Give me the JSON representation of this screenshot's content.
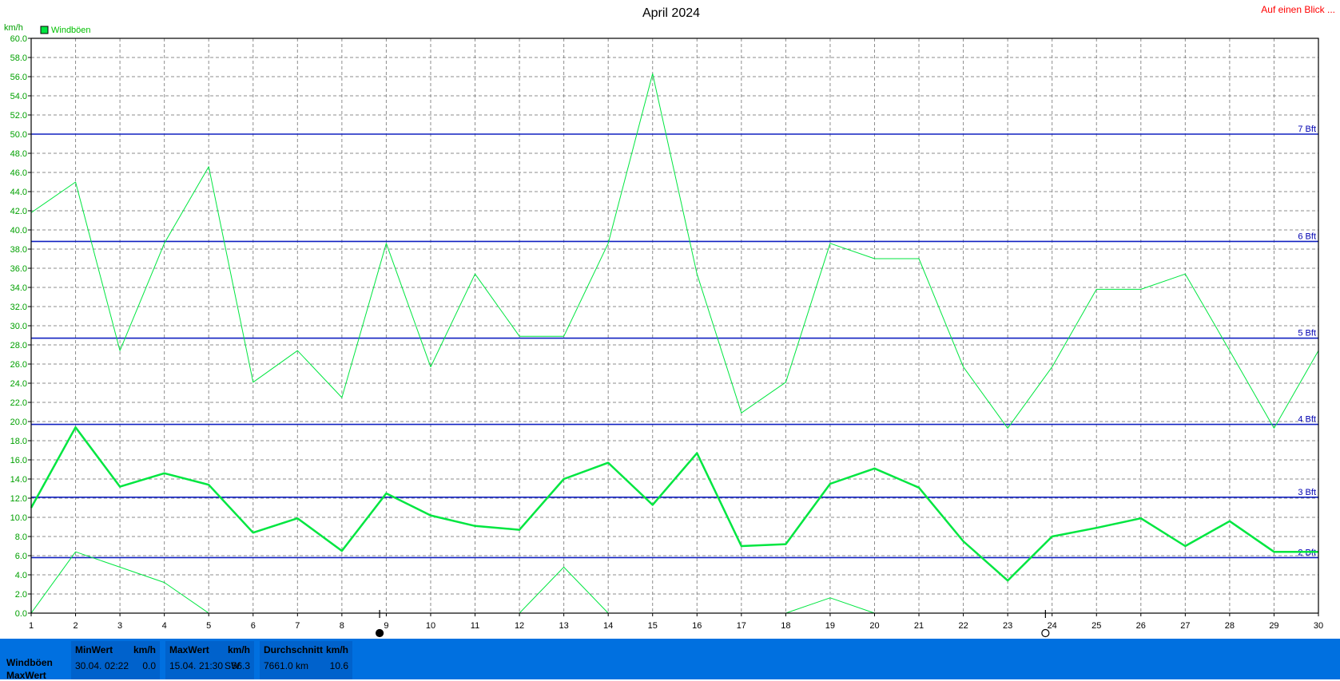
{
  "title": "April 2024",
  "link_text": "Auf einen Blick ...",
  "y_unit": "km/h",
  "legend": {
    "label": "Windböen",
    "color": "#00e640"
  },
  "colors": {
    "series": "#00e640",
    "bft": "#1020c0",
    "stats_bg": "#0070e0"
  },
  "chart_data": {
    "type": "line",
    "title": "April 2024",
    "ylabel": "km/h",
    "xlim": [
      1,
      30
    ],
    "ylim": [
      0,
      60
    ],
    "y_ticks": [
      "0.0",
      "2.0",
      "4.0",
      "6.0",
      "8.0",
      "10.0",
      "12.0",
      "14.0",
      "16.0",
      "18.0",
      "20.0",
      "22.0",
      "24.0",
      "26.0",
      "28.0",
      "30.0",
      "32.0",
      "34.0",
      "36.0",
      "38.0",
      "40.0",
      "42.0",
      "44.0",
      "46.0",
      "48.0",
      "50.0",
      "52.0",
      "54.0",
      "56.0",
      "58.0",
      "60.0"
    ],
    "x_ticks": [
      "1",
      "2",
      "3",
      "4",
      "5",
      "6",
      "7",
      "8",
      "9",
      "10",
      "11",
      "12",
      "13",
      "14",
      "15",
      "16",
      "17",
      "18",
      "19",
      "20",
      "21",
      "22",
      "23",
      "24",
      "25",
      "26",
      "27",
      "28",
      "29",
      "30"
    ],
    "grid": true,
    "legend_position": "top-left",
    "x": [
      1,
      2,
      3,
      4,
      5,
      6,
      7,
      8,
      9,
      10,
      11,
      12,
      13,
      14,
      15,
      16,
      17,
      18,
      19,
      20,
      21,
      22,
      23,
      24,
      25,
      26,
      27,
      28,
      29,
      30
    ],
    "series": [
      {
        "name": "Windböen",
        "role": "max",
        "width": 1,
        "values": [
          41.8,
          45.0,
          27.4,
          38.6,
          46.6,
          24.1,
          27.4,
          22.5,
          38.6,
          25.7,
          35.4,
          28.9,
          28.9,
          38.6,
          56.3,
          35.4,
          20.9,
          24.1,
          38.6,
          37.0,
          37.0,
          25.7,
          19.3,
          25.7,
          33.8,
          33.8,
          35.4,
          27.4,
          19.3,
          27.4
        ]
      },
      {
        "name": "",
        "role": "mean",
        "width": 2.5,
        "values": [
          11.0,
          19.4,
          13.2,
          14.6,
          13.4,
          8.4,
          9.9,
          6.5,
          12.5,
          10.2,
          9.1,
          8.7,
          14.0,
          15.7,
          11.3,
          16.7,
          7.0,
          7.2,
          13.5,
          15.1,
          13.1,
          7.5,
          3.4,
          8.0,
          8.9,
          9.9,
          7.0,
          9.6,
          6.4,
          6.4
        ]
      },
      {
        "name": "",
        "role": "min",
        "width": 1,
        "values": [
          0.0,
          6.4,
          4.8,
          3.2,
          0.0,
          null,
          null,
          null,
          null,
          null,
          null,
          0.0,
          4.8,
          0.0,
          null,
          null,
          null,
          0.0,
          1.6,
          0.0,
          null,
          null,
          null,
          null,
          null,
          null,
          null,
          null,
          null,
          null
        ]
      }
    ],
    "bft_levels": [
      {
        "label": "2 Bft",
        "value": 5.8
      },
      {
        "label": "3 Bft",
        "value": 12.1
      },
      {
        "label": "4 Bft",
        "value": 19.7
      },
      {
        "label": "5 Bft",
        "value": 28.7
      },
      {
        "label": "6 Bft",
        "value": 38.8
      },
      {
        "label": "7 Bft",
        "value": 50.0
      }
    ],
    "moon_markers": [
      {
        "day": 9,
        "phase": "new"
      },
      {
        "day": 24,
        "phase": "full"
      }
    ]
  },
  "stats": {
    "row_labels": [
      "Windböen",
      "MaxWert"
    ],
    "min": {
      "header": "MinWert",
      "unit": "km/h",
      "date": "30.04.",
      "time": "02:22",
      "value": "0.0"
    },
    "max": {
      "header": "MaxWert",
      "unit": "km/h",
      "date": "15.04.",
      "time": "21:30",
      "dir": "SW",
      "value": "56.3"
    },
    "avg": {
      "header": "Durchschnitt",
      "unit": "km/h",
      "distance": "7661.0 km",
      "value": "10.6"
    }
  }
}
